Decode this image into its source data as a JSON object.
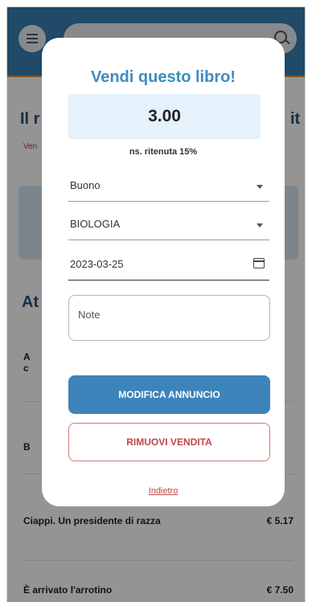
{
  "background": {
    "section_title_1": "Il r",
    "section_title_1_tail": "it",
    "red_label": "Ven",
    "section_title_2": "At",
    "items": [
      {
        "title": "A",
        "subtitle": "c",
        "price": ""
      },
      {
        "title": "B",
        "subtitle": "",
        "price": ""
      },
      {
        "title": "Ciappi. Un presidente di razza",
        "price": "€ 5.17"
      },
      {
        "title": "È arrivato l'arrotino",
        "price": "€ 7.50"
      }
    ]
  },
  "modal": {
    "title": "Vendi questo libro!",
    "price": "3.00",
    "fee_note": "ns. ritenuta 15%",
    "condition": {
      "value": "Buono"
    },
    "subject": {
      "value": "BIOLOGIA"
    },
    "date": {
      "value": "2023-03-25"
    },
    "notes": {
      "placeholder": "Note"
    },
    "primary_button": "MODIFICA ANNUNCIO",
    "secondary_button": "RIMUOVI VENDITA",
    "back_link": "Indietro"
  },
  "colors": {
    "accent": "#3d84bb",
    "danger": "#c0464b",
    "price_box": "#e5f1fb"
  }
}
